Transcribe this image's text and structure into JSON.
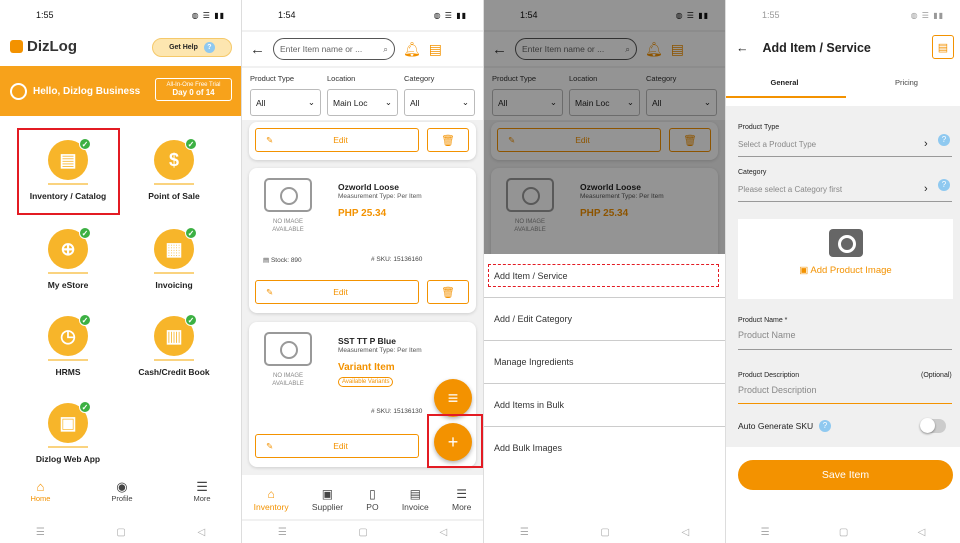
{
  "screen1": {
    "time": "1:55",
    "app_name": "DizLog",
    "get_help": "Get Help",
    "greeting": "Hello, Dizlog Business",
    "trial_line1": "All-In-One Free Trial",
    "trial_line2": "Day 0 of 14",
    "tiles": [
      "Inventory / Catalog",
      "Point of Sale",
      "My eStore",
      "Invoicing",
      "HRMS",
      "Cash/Credit Book",
      "Dizlog Web App"
    ],
    "nav": [
      "Home",
      "Profile",
      "More"
    ]
  },
  "screen2": {
    "time": "1:54",
    "search_placeholder": "Enter Item name or ...",
    "filters": {
      "labels": [
        "Product Type",
        "Location",
        "Category"
      ],
      "values": [
        "All",
        "Main Loc",
        "All"
      ]
    },
    "edit_label": "Edit",
    "no_image": "NO IMAGE AVAILABLE",
    "products": [
      {
        "name": "Ozworld Loose",
        "measurement": "Measurement Type: Per Item",
        "price": "PHP 25.34",
        "stock": "Stock: 890",
        "sku": "SKU: 15136160"
      },
      {
        "name": "SST TT P Blue",
        "measurement": "Measurement Type: Per Item",
        "price": "Variant Item",
        "badge": "Available Variants",
        "sku": "SKU: 15136130"
      }
    ],
    "nav": [
      "Inventory",
      "Supplier",
      "PO",
      "Invoice",
      "More"
    ]
  },
  "screen3": {
    "time": "1:54",
    "menu": [
      "Add Item / Service",
      "Add / Edit Category",
      "Manage Ingredients",
      "Add Items in Bulk",
      "Add Bulk Images"
    ]
  },
  "screen4": {
    "time": "1:55",
    "title": "Add Item / Service",
    "tabs": [
      "General",
      "Pricing"
    ],
    "product_type_label": "Product Type",
    "product_type_placeholder": "Select a Product Type",
    "category_label": "Category",
    "category_placeholder": "Please select a Category first",
    "add_image": "Add Product Image",
    "name_label": "Product Name *",
    "name_placeholder": "Product Name",
    "desc_label": "Product Description",
    "desc_optional": "(Optional)",
    "desc_placeholder": "Product Description",
    "auto_sku": "Auto Generate SKU",
    "save": "Save Item"
  },
  "colors": {
    "accent": "#f39200",
    "highlight": "#e31b23"
  }
}
